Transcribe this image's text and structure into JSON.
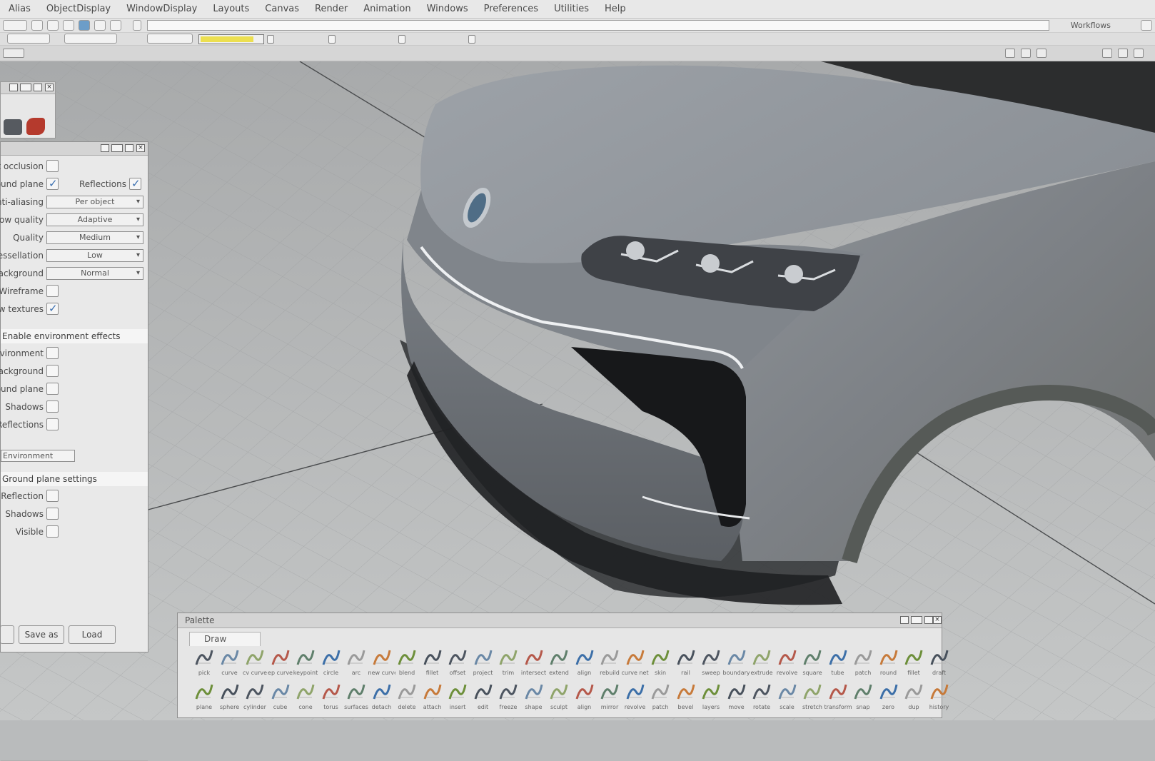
{
  "menubar": {
    "items": [
      "Alias",
      "ObjectDisplay",
      "WindowDisplay",
      "Layouts",
      "Canvas",
      "Render",
      "Animation",
      "Windows",
      "Preferences",
      "Utilities",
      "Help"
    ]
  },
  "toolbar": {
    "command_line_text": "",
    "prefs_label": "Workflows"
  },
  "attribute_editor": {
    "rows": [
      {
        "label": "Ambient occlusion",
        "type": "checkbox",
        "checked": false
      },
      {
        "label": "Ground plane",
        "type": "checkbox",
        "checked": true,
        "label2": "Reflections",
        "checked2": true
      },
      {
        "label": "Anti-aliasing",
        "type": "dropdown",
        "value": "Per object"
      },
      {
        "label": "Shadow quality",
        "type": "dropdown",
        "value": "Adaptive"
      },
      {
        "label": "Quality",
        "type": "dropdown",
        "value": "Medium"
      },
      {
        "label": "Tessellation",
        "type": "dropdown",
        "value": "Low"
      },
      {
        "label": "Background",
        "type": "dropdown",
        "value": "Normal"
      },
      {
        "label": "Wireframe",
        "type": "checkbox",
        "checked": false
      },
      {
        "label": "Show textures",
        "type": "checkbox",
        "checked": true
      }
    ],
    "section1": "Enable environment effects",
    "env_rows": [
      {
        "label": "Environment",
        "checked": false
      },
      {
        "label": "Background",
        "checked": false
      },
      {
        "label": "Ground plane",
        "checked": false
      },
      {
        "label": "Shadows",
        "checked": false
      },
      {
        "label": "Reflections",
        "checked": false
      }
    ],
    "env_field": "Environment",
    "section2": "Ground plane settings",
    "gp_rows": [
      {
        "label": "Reflection",
        "checked": false
      },
      {
        "label": "Shadows",
        "checked": false
      },
      {
        "label": "Visible",
        "checked": false
      }
    ],
    "buttons": [
      "Save as",
      "Load"
    ]
  },
  "palette": {
    "title": "Palette",
    "tab": "Draw",
    "row1": [
      "pick",
      "curve",
      "cv curve",
      "ep curve",
      "keypoint",
      "circle",
      "arc",
      "new curve",
      "blend",
      "fillet",
      "offset",
      "project",
      "trim",
      "intersect",
      "extend",
      "align",
      "rebuild",
      "curve net",
      "skin",
      "rail",
      "sweep",
      "boundary",
      "extrude",
      "revolve",
      "square",
      "tube",
      "patch",
      "round",
      "fillet",
      "draft"
    ],
    "row2": [
      "plane",
      "sphere",
      "cylinder",
      "cube",
      "cone",
      "torus",
      "surfaces",
      "detach",
      "delete",
      "attach",
      "insert",
      "edit",
      "freeze",
      "shape",
      "sculpt",
      "align",
      "mirror",
      "revolve",
      "patch",
      "bevel",
      "layers",
      "move",
      "rotate",
      "scale",
      "stretch",
      "transform",
      "snap",
      "zero",
      "dup",
      "history"
    ]
  },
  "colors": {
    "accent": "#3a6fb0",
    "highlight_yellow": "#ecdf50"
  }
}
